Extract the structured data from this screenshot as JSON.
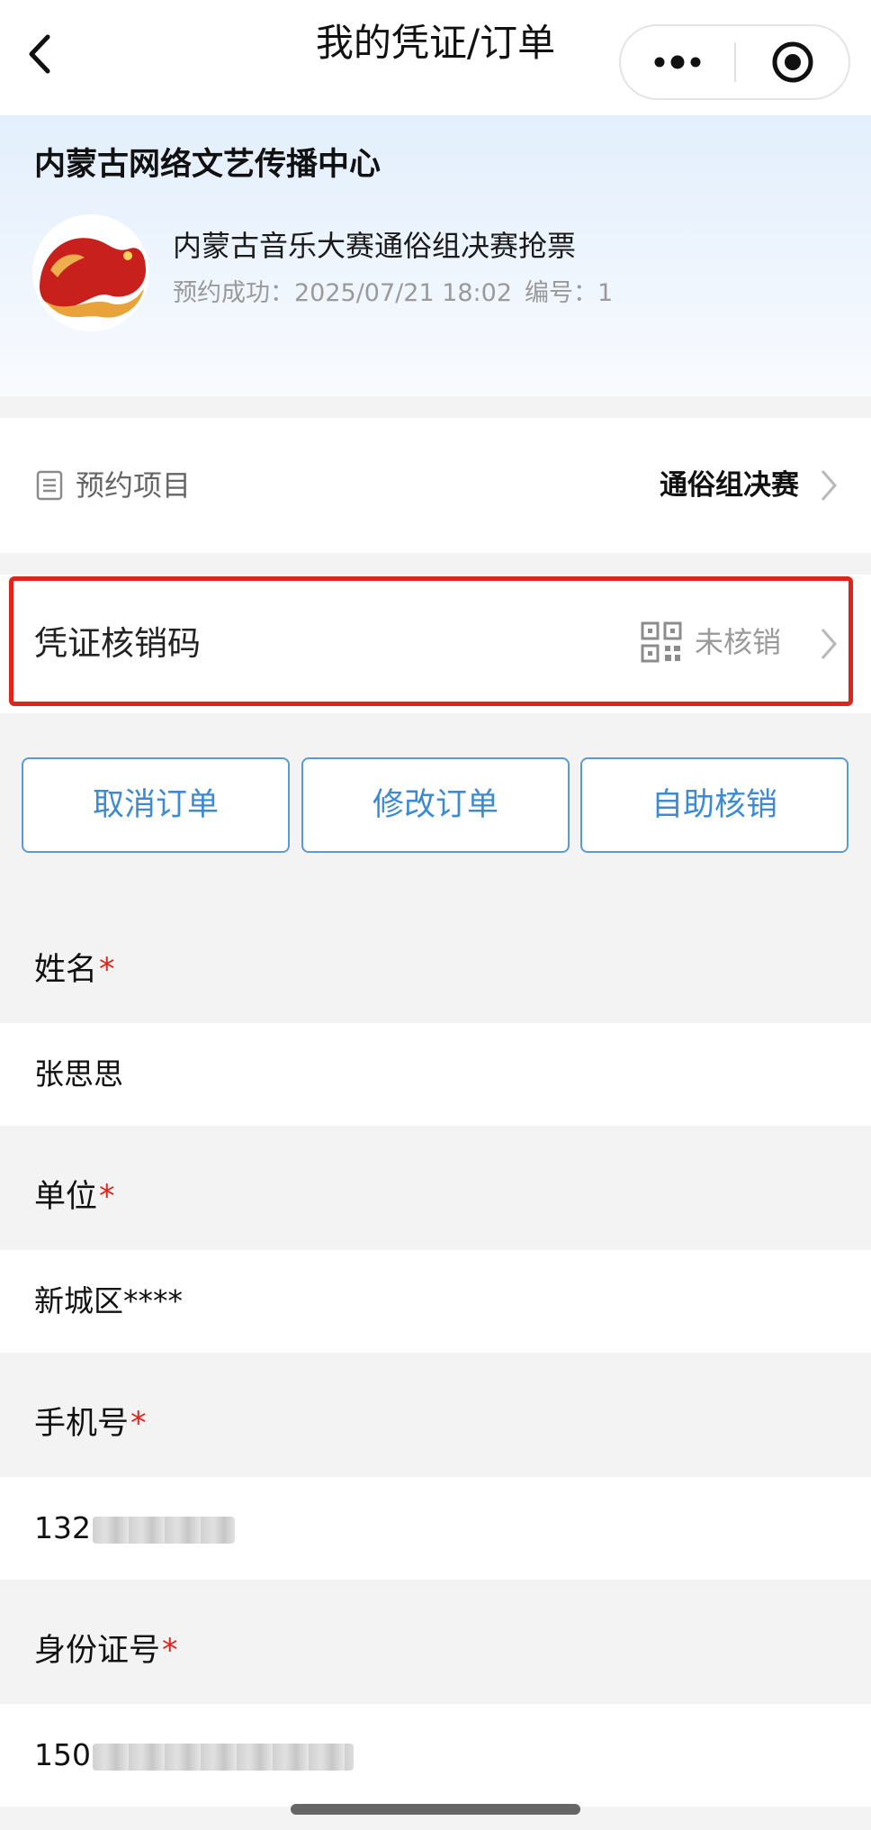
{
  "navbar": {
    "title": "我的凭证/订单"
  },
  "header": {
    "org_name": "内蒙古网络文艺传播中心",
    "event_title": "内蒙古音乐大赛通俗组决赛抢票",
    "success_text": "预约成功：2025/07/21 18:02",
    "serial_text": "编号：1"
  },
  "project_row": {
    "label": "预约项目",
    "value": "通俗组决赛"
  },
  "voucher_row": {
    "label": "凭证核销码",
    "status": "未核销"
  },
  "actions": {
    "cancel": "取消订单",
    "modify": "修改订单",
    "self_verify": "自助核销"
  },
  "fields": [
    {
      "label": "姓名",
      "required_mark": "*",
      "value": "张思思"
    },
    {
      "label": "单位",
      "required_mark": "*",
      "value": "新城区****"
    },
    {
      "label": "手机号",
      "required_mark": "*",
      "value": "132"
    },
    {
      "label": "身份证号",
      "required_mark": "*",
      "value": "150"
    }
  ],
  "colors": {
    "accent_blue": "#3d8ad4",
    "highlight_red": "#e0241c",
    "required_red": "#e0241c"
  }
}
